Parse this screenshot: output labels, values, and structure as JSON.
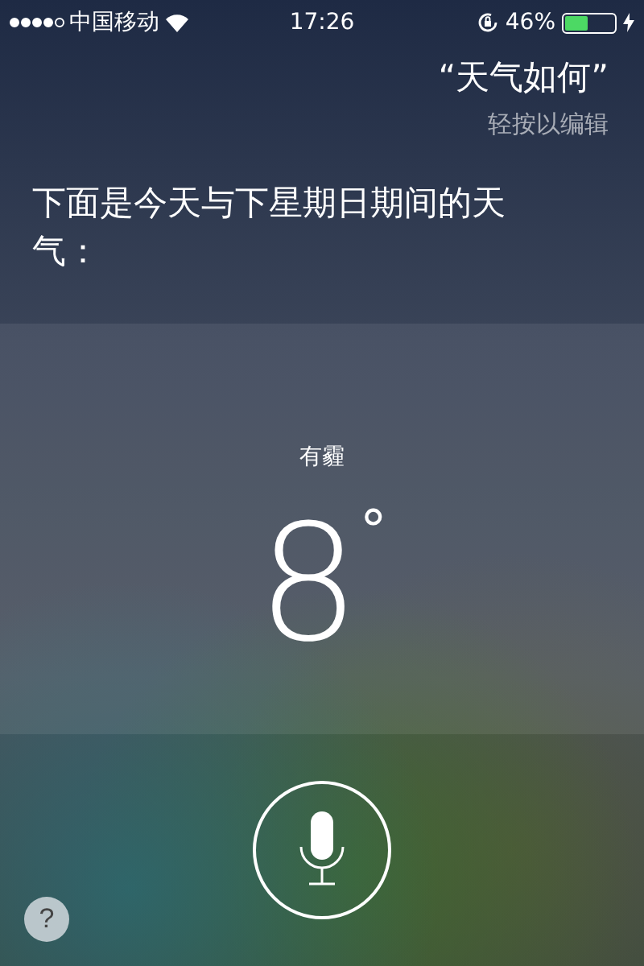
{
  "status_bar": {
    "carrier": "中国移动",
    "time": "17:26",
    "battery_percent": "46%",
    "battery": {
      "level": 0.46
    },
    "charging": true,
    "rotation_lock": true
  },
  "query": {
    "text": "“天气如何”",
    "hint": "轻按以编辑"
  },
  "response": "下面是今天与下星期日期间的天气：",
  "weather": {
    "condition": "有霾",
    "temperature": "8",
    "unit": "°"
  },
  "help_button": "?"
}
